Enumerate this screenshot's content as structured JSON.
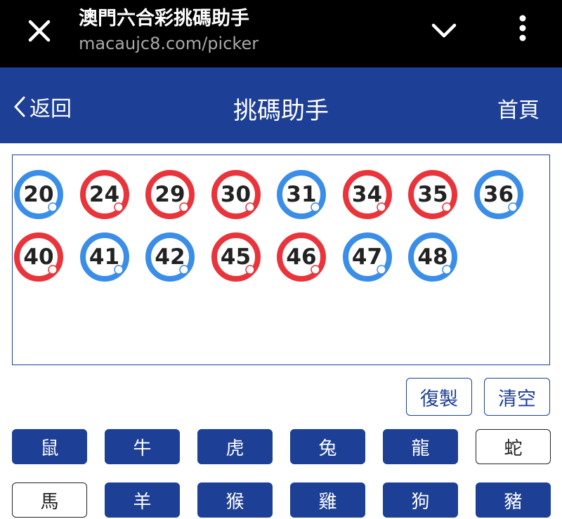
{
  "browser": {
    "title": "澳門六合彩挑碼助手",
    "url": "macaujc8.com/picker"
  },
  "header": {
    "back_label": "返回",
    "title": "挑碼助手",
    "home_label": "首頁"
  },
  "colors": {
    "primary": "#1d3f95",
    "ball_red": "#e8343a",
    "ball_blue": "#3b8ee8"
  },
  "picked_numbers": [
    {
      "n": "20",
      "color": "blue"
    },
    {
      "n": "24",
      "color": "red"
    },
    {
      "n": "29",
      "color": "red"
    },
    {
      "n": "30",
      "color": "red"
    },
    {
      "n": "31",
      "color": "blue"
    },
    {
      "n": "34",
      "color": "red"
    },
    {
      "n": "35",
      "color": "red"
    },
    {
      "n": "36",
      "color": "blue"
    },
    {
      "n": "40",
      "color": "red"
    },
    {
      "n": "41",
      "color": "blue"
    },
    {
      "n": "42",
      "color": "blue"
    },
    {
      "n": "45",
      "color": "red"
    },
    {
      "n": "46",
      "color": "red"
    },
    {
      "n": "47",
      "color": "blue"
    },
    {
      "n": "48",
      "color": "blue"
    }
  ],
  "actions": {
    "copy_label": "復製",
    "clear_label": "清空"
  },
  "zodiacs": [
    {
      "label": "鼠",
      "selected": true
    },
    {
      "label": "牛",
      "selected": true
    },
    {
      "label": "虎",
      "selected": true
    },
    {
      "label": "兔",
      "selected": true
    },
    {
      "label": "龍",
      "selected": true
    },
    {
      "label": "蛇",
      "selected": false
    },
    {
      "label": "馬",
      "selected": false
    },
    {
      "label": "羊",
      "selected": true
    },
    {
      "label": "猴",
      "selected": true
    },
    {
      "label": "雞",
      "selected": true
    },
    {
      "label": "狗",
      "selected": true
    },
    {
      "label": "豬",
      "selected": true
    }
  ]
}
